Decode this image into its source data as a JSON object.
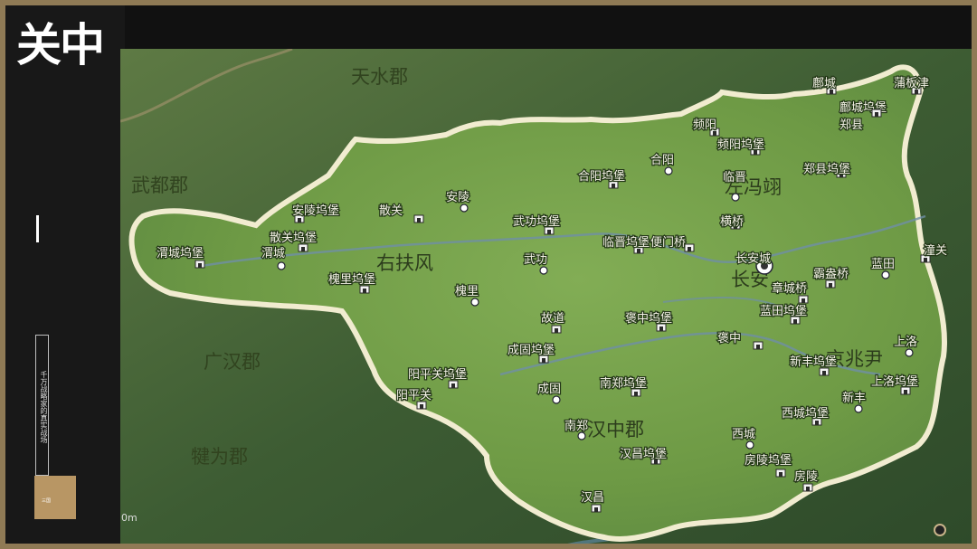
{
  "page": {
    "title": "关中",
    "tagline": "千万战略家的真实战场",
    "brand": "三国"
  },
  "map": {
    "scale_label": "0m",
    "scale_sub": "",
    "regions": [
      {
        "name": "天水郡"
      },
      {
        "name": "武都郡"
      },
      {
        "name": "右扶风"
      },
      {
        "name": "左冯翊"
      },
      {
        "name": "长安"
      },
      {
        "name": "京兆尹"
      },
      {
        "name": "广汉郡"
      },
      {
        "name": "汉中郡"
      },
      {
        "name": "犍为郡"
      }
    ],
    "places": [
      {
        "name": "蒲板津",
        "kind": "fort"
      },
      {
        "name": "鄜城",
        "kind": "fort"
      },
      {
        "name": "鄜城坞堡",
        "kind": "fort"
      },
      {
        "name": "郑县",
        "kind": "fort"
      },
      {
        "name": "频阳",
        "kind": "fort"
      },
      {
        "name": "频阳坞堡",
        "kind": "fort"
      },
      {
        "name": "合阳",
        "kind": "city"
      },
      {
        "name": "郑县坞堡",
        "kind": "fort"
      },
      {
        "name": "合阳坞堡",
        "kind": "fort"
      },
      {
        "name": "临晋",
        "kind": "city"
      },
      {
        "name": "安陵",
        "kind": "city"
      },
      {
        "name": "散关",
        "kind": "fort"
      },
      {
        "name": "安陵坞堡",
        "kind": "fort"
      },
      {
        "name": "武功坞堡",
        "kind": "fort"
      },
      {
        "name": "横桥",
        "kind": "fort"
      },
      {
        "name": "散关坞堡",
        "kind": "fort"
      },
      {
        "name": "临晋坞堡",
        "kind": "fort"
      },
      {
        "name": "便门桥",
        "kind": "fort"
      },
      {
        "name": "长安城",
        "kind": "capital"
      },
      {
        "name": "蓝田",
        "kind": "city"
      },
      {
        "name": "潼关",
        "kind": "fort"
      },
      {
        "name": "渭城坞堡",
        "kind": "fort"
      },
      {
        "name": "渭城",
        "kind": "city"
      },
      {
        "name": "武功",
        "kind": "city"
      },
      {
        "name": "霸盎桥",
        "kind": "fort"
      },
      {
        "name": "槐里坞堡",
        "kind": "fort"
      },
      {
        "name": "章城桥",
        "kind": "fort"
      },
      {
        "name": "槐里",
        "kind": "city"
      },
      {
        "name": "蓝田坞堡",
        "kind": "fort"
      },
      {
        "name": "故道",
        "kind": "fort"
      },
      {
        "name": "褒中坞堡",
        "kind": "fort"
      },
      {
        "name": "褒中",
        "kind": "fort"
      },
      {
        "name": "上洛",
        "kind": "city"
      },
      {
        "name": "成固坞堡",
        "kind": "fort"
      },
      {
        "name": "新丰坞堡",
        "kind": "fort"
      },
      {
        "name": "阳平关坞堡",
        "kind": "fort"
      },
      {
        "name": "上洛坞堡",
        "kind": "fort"
      },
      {
        "name": "成固",
        "kind": "city"
      },
      {
        "name": "南郑坞堡",
        "kind": "fort"
      },
      {
        "name": "阳平关",
        "kind": "fort"
      },
      {
        "name": "新丰",
        "kind": "city"
      },
      {
        "name": "西城坞堡",
        "kind": "fort"
      },
      {
        "name": "南郑",
        "kind": "city"
      },
      {
        "name": "西城",
        "kind": "city"
      },
      {
        "name": "汉昌坞堡",
        "kind": "fort"
      },
      {
        "name": "房陵坞堡",
        "kind": "fort"
      },
      {
        "name": "房陵",
        "kind": "fort"
      },
      {
        "name": "汉昌",
        "kind": "fort"
      }
    ]
  },
  "colors": {
    "frame": "#8f7a55",
    "territory": "#6f9a44",
    "outer": "#3b5c33",
    "border": "#f1ecd0",
    "river": "#6f8fa6"
  }
}
